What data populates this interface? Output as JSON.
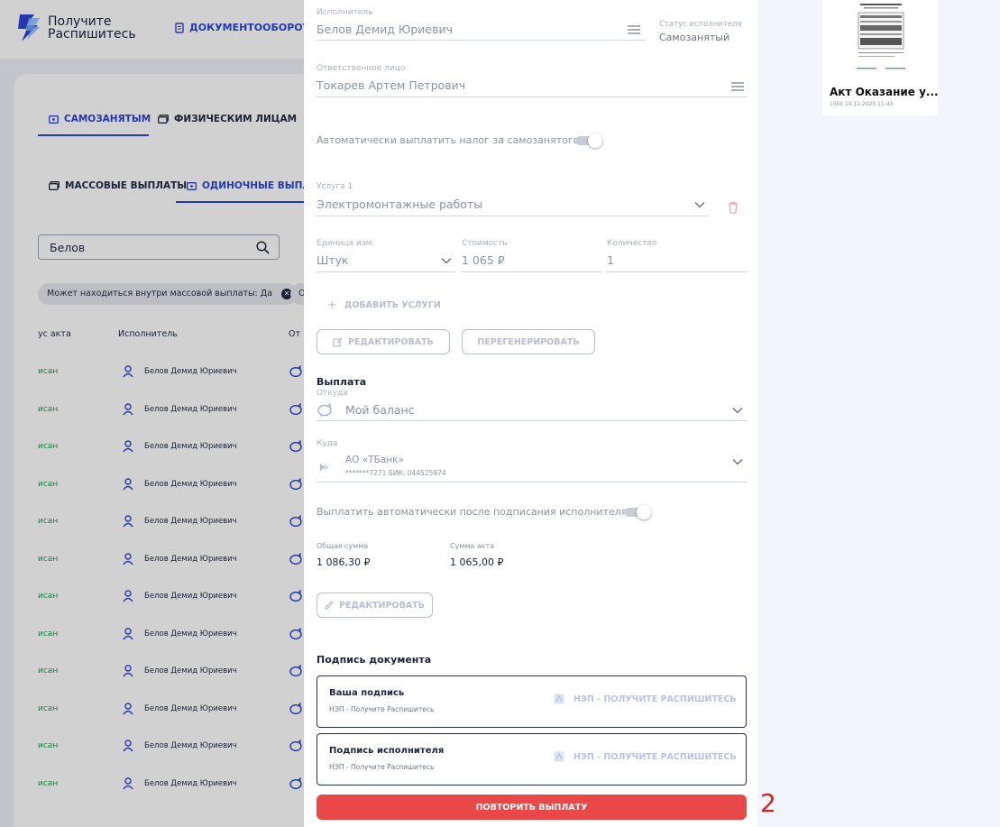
{
  "app": {
    "logo_line1": "Получите",
    "logo_line2": "Распишитесь",
    "nav_documents": "ДОКУМЕНТООБОРОТ",
    "brand_color": "#2b46d6"
  },
  "background": {
    "tabs_top": [
      "САМОЗАНЯТЫМ",
      "ФИЗИЧЕСКИМ ЛИЦАМ"
    ],
    "tabs_payments": [
      "МАССОВЫЕ ВЫПЛАТЫ",
      "ОДИНОЧНЫЕ ВЫПЛАТ"
    ],
    "search_value": "Белов",
    "chip_label": "Может находиться внутри массовой выплаты: Да",
    "chip2_label": "О",
    "columns": [
      "ус акта",
      "Исполнитель",
      "От"
    ],
    "rows": [
      {
        "status": "исан",
        "name": "Белов Демид Юриевич"
      },
      {
        "status": "исан",
        "name": "Белов Демид Юриевич"
      },
      {
        "status": "исан",
        "name": "Белов Демид Юриевич"
      },
      {
        "status": "исан",
        "name": "Белов Демид Юриевич"
      },
      {
        "status": "исан",
        "name": "Белов Демид Юриевич"
      },
      {
        "status": "исан",
        "name": "Белов Демид Юриевич"
      },
      {
        "status": "исан",
        "name": "Белов Демид Юриевич"
      },
      {
        "status": "исан",
        "name": "Белов Демид Юриевич"
      },
      {
        "status": "исан",
        "name": "Белов Демид Юриевич"
      },
      {
        "status": "исан",
        "name": "Белов Демид Юриевич"
      },
      {
        "status": "исан",
        "name": "Белов Демид Юриевич"
      },
      {
        "status": "исан",
        "name": "Белов Демид Юриевич"
      }
    ]
  },
  "panel": {
    "executor_label": "Исполнитель",
    "executor_value": "Белов Демид Юриевич",
    "executor_status_label": "Статус исполнителя",
    "executor_status_value": "Самозанятый",
    "responsible_label": "Ответственное лицо",
    "responsible_value": "Токарев Артем Петрович",
    "auto_tax_label": "Автоматически выплатить налог за самозанятого",
    "service_label": "Услуга 1",
    "service_value": "Электромонтажные работы",
    "unit_label": "Единица изм.",
    "unit_value": "Штук",
    "price_label": "Стоимость",
    "price_value": "1 065 ₽",
    "qty_label": "Количество",
    "qty_value": "1",
    "add_service": "ДОБАВИТЬ УСЛУГИ",
    "edit_button": "РЕДАКТИРОВАТЬ",
    "regenerate_button": "ПЕРЕГЕНЕРИРОВАТЬ",
    "payment_title": "Выплата",
    "from_label": "Откуда",
    "from_value": "Мой баланс",
    "to_label": "Куда",
    "bank_name": "АО «ТБанк»",
    "bank_details": "*******7271 БИК: 044525974",
    "auto_pay_label": "Выплатить автоматически после подписания исполнителя",
    "total_label": "Общая сумма",
    "total_value": "1 086,30 ₽",
    "act_sum_label": "Сумма акта",
    "act_sum_value": "1 065,00 ₽",
    "edit_button2": "РЕДАКТИРОВАТЬ",
    "sign_title": "Подпись документа",
    "sign_boxes": [
      {
        "title": "Ваша подпись",
        "sub": "НЭП - Получите Распишитесь",
        "action": "НЭП - ПОЛУЧИТЕ РАСПИШИТЕСЬ"
      },
      {
        "title": "Подпись исполнителя",
        "sub": "НЭП - Получите Распишитесь",
        "action": "НЭП - ПОЛУЧИТЕ РАСПИШИТЕСЬ"
      }
    ],
    "repeat_payment_button": "ПОВТОРИТЬ ВЫПЛАТУ",
    "accent_red": "#e94848"
  },
  "preview": {
    "title": "Акт Оказание у...",
    "meta": "15kb 14.11.2025 11:43"
  },
  "annotation": "2"
}
